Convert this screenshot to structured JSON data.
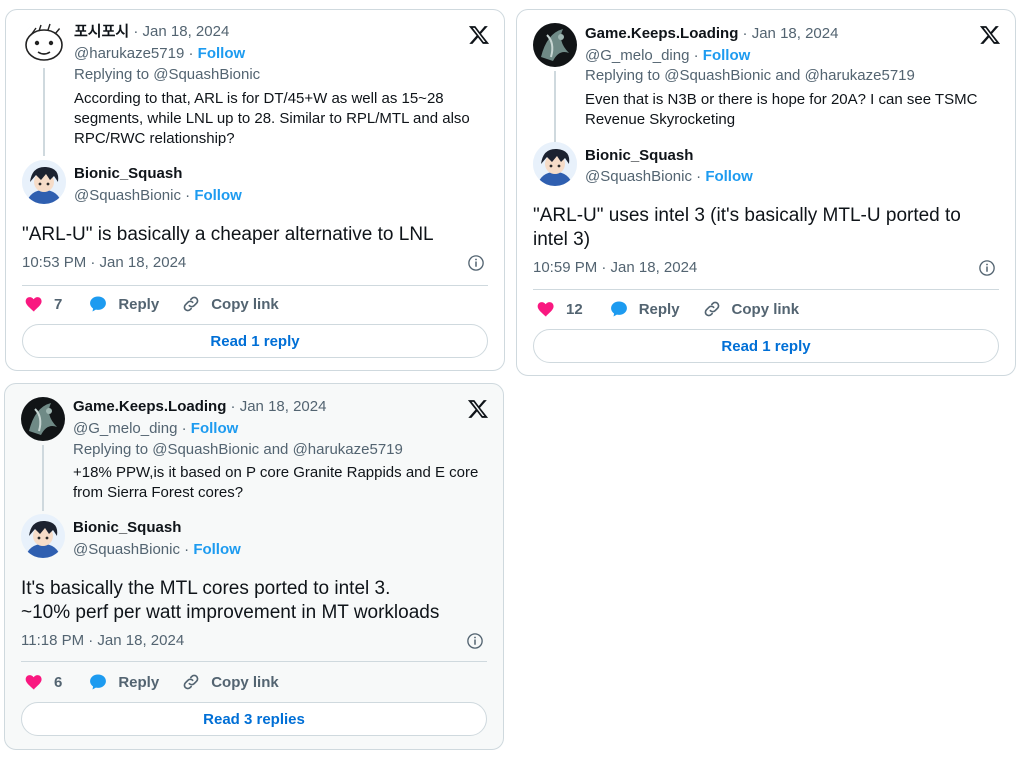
{
  "colors": {
    "accent": "#1d9bf0",
    "like": "#f91880",
    "muted": "#536471",
    "border": "#cfd9de"
  },
  "cards": [
    {
      "parent": {
        "name": "포시포시",
        "date_sep": "·",
        "date": "Jan 18, 2024",
        "handle": "@harukaze5719",
        "follow": "Follow",
        "replying_prefix": "Replying to",
        "replying_to": "@SquashBionic",
        "replying_and": "",
        "replying_to2": "",
        "text": "According to that, ARL is for DT/45+W as well as 15~28 segments, while LNL up to 28. Similar to RPL/MTL and also RPC/RWC relationship?",
        "avatar_icon": "doodle-face-avatar"
      },
      "reply": {
        "name": "Bionic_Squash",
        "handle": "@SquashBionic",
        "follow": "Follow",
        "text": "\"ARL-U\" is basically a cheaper alternative to LNL",
        "time": "10:53 PM · Jan 18, 2024",
        "avatar_icon": "anime-avatar"
      },
      "likes": "7",
      "reply_label": "Reply",
      "copy_label": "Copy link",
      "read_label": "Read 1 reply"
    },
    {
      "parent": {
        "name": "Game.Keeps.Loading",
        "date_sep": "·",
        "date": "Jan 18, 2024",
        "handle": "@G_melo_ding",
        "follow": "Follow",
        "replying_prefix": "Replying to",
        "replying_to": "@SquashBionic",
        "replying_and": "and",
        "replying_to2": "@harukaze5719",
        "text": "Even that is N3B or there is hope for 20A? I can see TSMC Revenue Skyrocketing",
        "avatar_icon": "dark-art-avatar"
      },
      "reply": {
        "name": "Bionic_Squash",
        "handle": "@SquashBionic",
        "follow": "Follow",
        "text": "\"ARL-U\" uses intel 3 (it's basically MTL-U ported to intel 3)",
        "time": "10:59 PM · Jan 18, 2024",
        "avatar_icon": "anime-avatar"
      },
      "likes": "12",
      "reply_label": "Reply",
      "copy_label": "Copy link",
      "read_label": "Read 1 reply"
    },
    {
      "parent": {
        "name": "Game.Keeps.Loading",
        "date_sep": "·",
        "date": "Jan 18, 2024",
        "handle": "@G_melo_ding",
        "follow": "Follow",
        "replying_prefix": "Replying to",
        "replying_to": "@SquashBionic",
        "replying_and": "and",
        "replying_to2": "@harukaze5719",
        "text": "+18% PPW,is it based on P core Granite  Rappids and  E core from Sierra Forest cores?",
        "avatar_icon": "dark-art-avatar"
      },
      "reply": {
        "name": "Bionic_Squash",
        "handle": "@SquashBionic",
        "follow": "Follow",
        "text": "It's basically the MTL cores ported to intel 3.\n~10% perf per watt improvement in MT workloads",
        "time": "11:18 PM · Jan 18, 2024",
        "avatar_icon": "anime-avatar"
      },
      "likes": "6",
      "reply_label": "Reply",
      "copy_label": "Copy link",
      "read_label": "Read 3 replies"
    }
  ]
}
